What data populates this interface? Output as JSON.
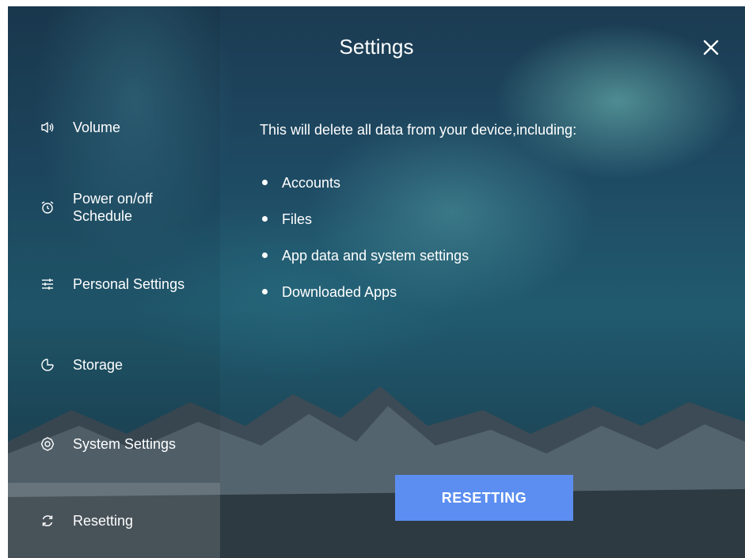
{
  "header": {
    "title": "Settings",
    "close_icon": "close-icon"
  },
  "sidebar": {
    "items": [
      {
        "label": "Volume",
        "icon": "speaker-icon"
      },
      {
        "label": "Power on/off Schedule",
        "icon": "alarm-clock-icon"
      },
      {
        "label": "Personal Settings",
        "icon": "sliders-icon"
      },
      {
        "label": "Storage",
        "icon": "pie-chart-icon"
      },
      {
        "label": "System Settings",
        "icon": "gear-icon"
      },
      {
        "label": "Resetting",
        "icon": "refresh-icon",
        "active": true
      }
    ]
  },
  "main": {
    "intro": "This will delete all data from your device,including:",
    "bullets": [
      "Accounts",
      "Files",
      "App data and system settings",
      "Downloaded Apps"
    ],
    "action_button": "RESETTING"
  },
  "colors": {
    "accent": "#5b8ef0",
    "text": "#ffffff"
  }
}
